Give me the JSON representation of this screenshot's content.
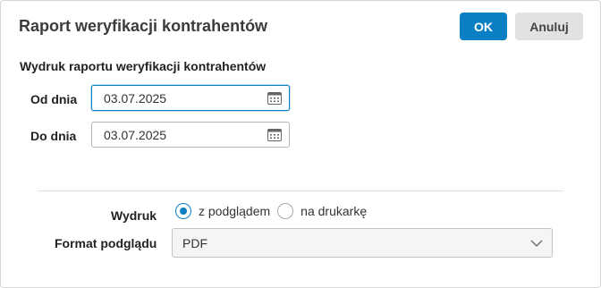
{
  "dialog": {
    "title": "Raport weryfikacji kontrahentów",
    "ok_label": "OK",
    "cancel_label": "Anuluj"
  },
  "section": {
    "title": "Wydruk raportu weryfikacji kontrahentów"
  },
  "from_date": {
    "label": "Od dnia",
    "value": "03.07.2025",
    "icon": "calendar-icon"
  },
  "to_date": {
    "label": "Do dnia",
    "value": "03.07.2025",
    "icon": "calendar-icon"
  },
  "print": {
    "label": "Wydruk",
    "options": [
      {
        "label": "z podglądem",
        "selected": true
      },
      {
        "label": "na drukarkę",
        "selected": false
      }
    ]
  },
  "preview_format": {
    "label": "Format podglądu",
    "selected": "PDF",
    "icon": "chevron-down-icon"
  },
  "colors": {
    "accent": "#0a7fc4",
    "cancel_bg": "#e2e2e2"
  }
}
